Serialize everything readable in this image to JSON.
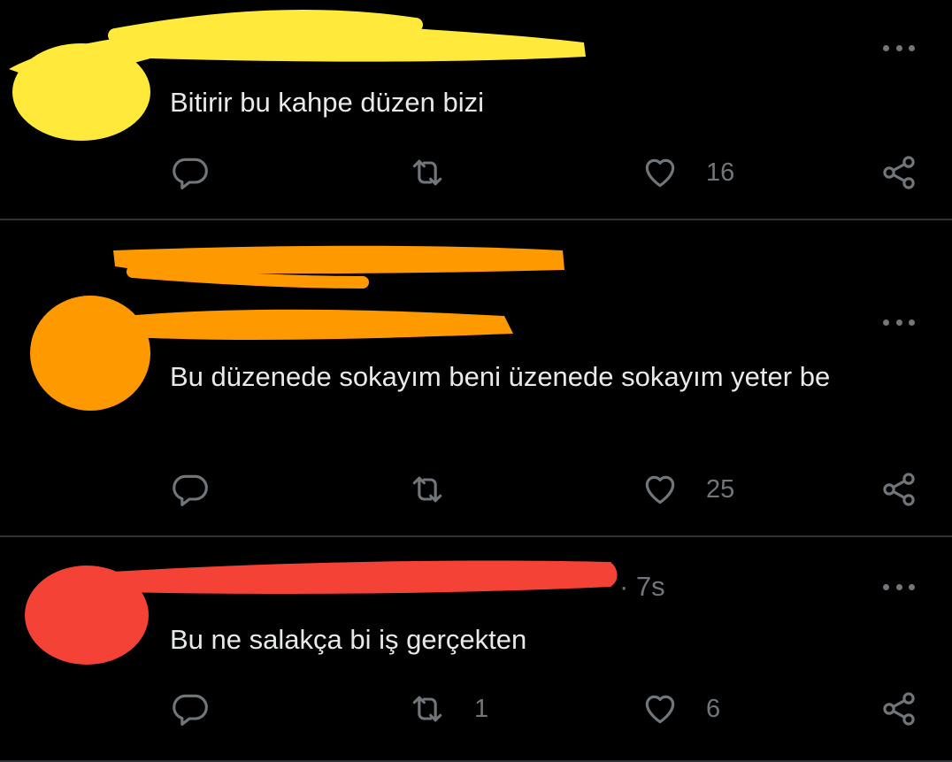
{
  "tweets": [
    {
      "time": "",
      "text": "Bitirir bu kahpe düzen bizi",
      "actions": {
        "reply": {
          "icon": "reply-icon",
          "count": ""
        },
        "retweet": {
          "icon": "retweet-icon",
          "count": ""
        },
        "like": {
          "icon": "heart-icon",
          "count": "16"
        },
        "share": {
          "icon": "share-icon",
          "count": ""
        }
      },
      "redaction_color": "#ffe93a"
    },
    {
      "time": "",
      "text": "Bu düzenede sokayım beni üzenede sokayım yeter be",
      "actions": {
        "reply": {
          "icon": "reply-icon",
          "count": ""
        },
        "retweet": {
          "icon": "retweet-icon",
          "count": ""
        },
        "like": {
          "icon": "heart-icon",
          "count": "25"
        },
        "share": {
          "icon": "share-icon",
          "count": ""
        }
      },
      "redaction_color": "#ff9900"
    },
    {
      "time": "· 7s",
      "text": "Bu ne salakça bi iş gerçekten",
      "actions": {
        "reply": {
          "icon": "reply-icon",
          "count": ""
        },
        "retweet": {
          "icon": "retweet-icon",
          "count": "1"
        },
        "like": {
          "icon": "heart-icon",
          "count": "6"
        },
        "share": {
          "icon": "share-icon",
          "count": ""
        }
      },
      "redaction_color": "#f44336"
    }
  ],
  "colors": {
    "background": "#000000",
    "text": "#e7e9ea",
    "muted": "#71767b",
    "divider": "#2f3336"
  },
  "icons": {
    "more": "more-horizontal-icon"
  }
}
